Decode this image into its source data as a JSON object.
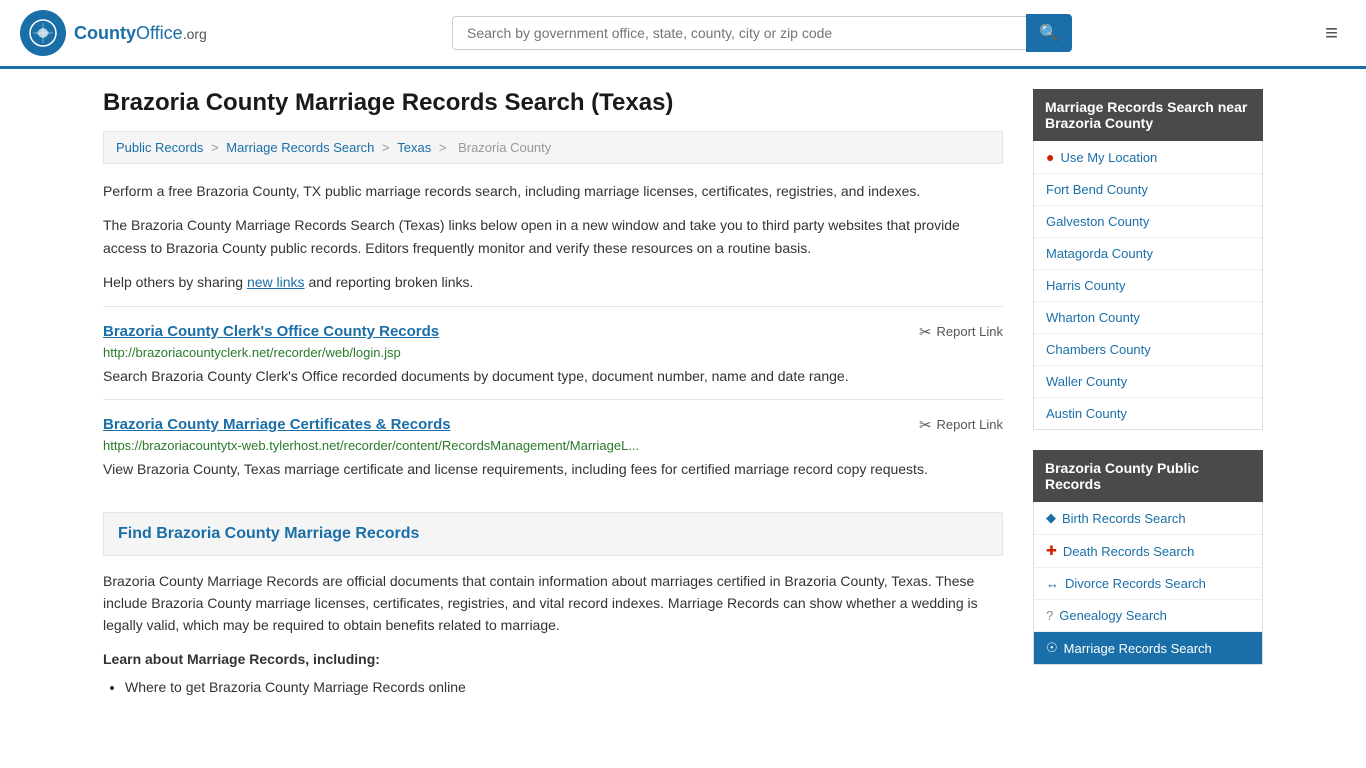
{
  "header": {
    "logo_text": "County",
    "logo_org": "Office",
    "logo_tld": ".org",
    "search_placeholder": "Search by government office, state, county, city or zip code",
    "menu_icon": "≡"
  },
  "page": {
    "title": "Brazoria County Marriage Records Search (Texas)"
  },
  "breadcrumb": {
    "items": [
      "Public Records",
      "Marriage Records Search",
      "Texas",
      "Brazoria County"
    ]
  },
  "description": {
    "para1": "Perform a free Brazoria County, TX public marriage records search, including marriage licenses, certificates, registries, and indexes.",
    "para2": "The Brazoria County Marriage Records Search (Texas) links below open in a new window and take you to third party websites that provide access to Brazoria County public records. Editors frequently monitor and verify these resources on a routine basis.",
    "para3_prefix": "Help others by sharing ",
    "para3_link": "new links",
    "para3_suffix": " and reporting broken links."
  },
  "records": [
    {
      "title": "Brazoria County Clerk's Office County Records",
      "url": "http://brazoriacountyclerk.net/recorder/web/login.jsp",
      "desc": "Search Brazoria County Clerk's Office recorded documents by document type, document number, name and date range.",
      "report_label": "Report Link"
    },
    {
      "title": "Brazoria County Marriage Certificates & Records",
      "url": "https://brazoriacountytx-web.tylerhost.net/recorder/content/RecordsManagement/MarriageL...",
      "desc": "View Brazoria County, Texas marriage certificate and license requirements, including fees for certified marriage record copy requests.",
      "report_label": "Report Link"
    }
  ],
  "find_section": {
    "heading": "Find Brazoria County Marriage Records",
    "content": "Brazoria County Marriage Records are official documents that contain information about marriages certified in Brazoria County, Texas. These include Brazoria County marriage licenses, certificates, registries, and vital record indexes. Marriage Records can show whether a wedding is legally valid, which may be required to obtain benefits related to marriage.",
    "learn_heading": "Learn about Marriage Records, including:",
    "learn_items": [
      "Where to get Brazoria County Marriage Records online"
    ]
  },
  "sidebar": {
    "nearby_title": "Marriage Records Search near Brazoria County",
    "use_my_location": "Use My Location",
    "nearby_counties": [
      "Fort Bend County",
      "Galveston County",
      "Matagorda County",
      "Harris County",
      "Wharton County",
      "Chambers County",
      "Waller County",
      "Austin County"
    ],
    "public_records_title": "Brazoria County Public Records",
    "public_records": [
      {
        "label": "Birth Records Search",
        "icon": "birth"
      },
      {
        "label": "Death Records Search",
        "icon": "cross"
      },
      {
        "label": "Divorce Records Search",
        "icon": "arrows"
      },
      {
        "label": "Genealogy Search",
        "icon": "question"
      },
      {
        "label": "Marriage Records Search",
        "icon": "gear",
        "active": true
      }
    ]
  }
}
